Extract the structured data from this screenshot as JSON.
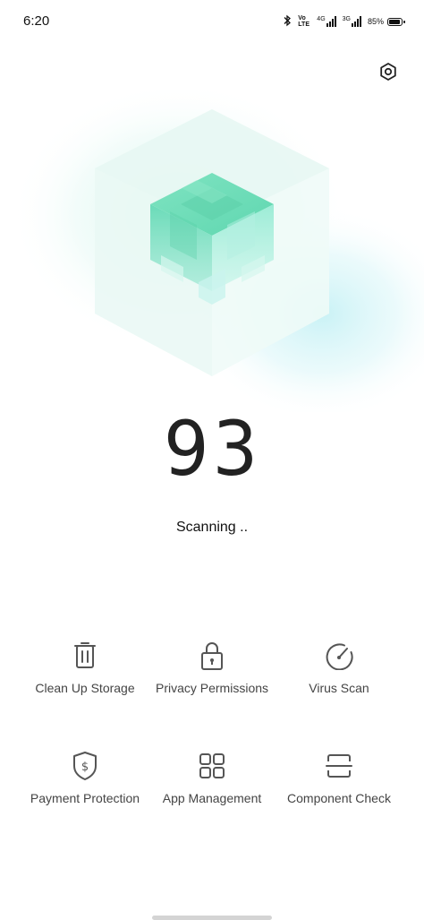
{
  "status_bar": {
    "time": "6:20",
    "volte_label": "Vo LTE",
    "net1": "4G",
    "net2": "3G",
    "battery_percent": "85%"
  },
  "header": {
    "settings_icon": "settings-gear-icon"
  },
  "scan": {
    "score": "93",
    "status_text": "Scanning .."
  },
  "features": [
    {
      "label": "Clean Up Storage",
      "icon": "trash-icon"
    },
    {
      "label": "Privacy Permissions",
      "icon": "lock-icon"
    },
    {
      "label": "Virus Scan",
      "icon": "speedometer-icon"
    },
    {
      "label": "Payment Protection",
      "icon": "shield-dollar-icon"
    },
    {
      "label": "App Management",
      "icon": "grid-icon"
    },
    {
      "label": "Component Check",
      "icon": "scan-frame-icon"
    }
  ],
  "colors": {
    "accent_teal": "#4fd1a5",
    "glow_cyan": "#bdf1f3",
    "icon_gray": "#555555"
  }
}
